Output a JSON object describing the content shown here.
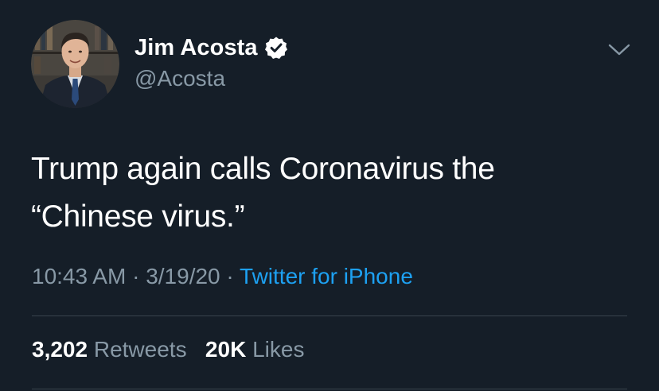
{
  "author": {
    "display_name": "Jim Acosta",
    "handle": "@Acosta",
    "verified": true
  },
  "icons": {
    "verified": "verified-badge-icon",
    "menu": "chevron-down-icon"
  },
  "tweet": {
    "text_line1": "Trump again calls Coronavirus the",
    "text_line2": "“Chinese virus.”"
  },
  "meta": {
    "time": "10:43 AM",
    "sep1": "·",
    "date": "3/19/20",
    "sep2": "·",
    "source": "Twitter for iPhone"
  },
  "stats": {
    "retweets_count": "3,202",
    "retweets_label": "Retweets",
    "likes_count": "20K",
    "likes_label": "Likes"
  },
  "colors": {
    "background": "#151e28",
    "text": "#ffffff",
    "muted": "#8899a6",
    "link": "#1da1f2",
    "divider": "#38444d"
  }
}
